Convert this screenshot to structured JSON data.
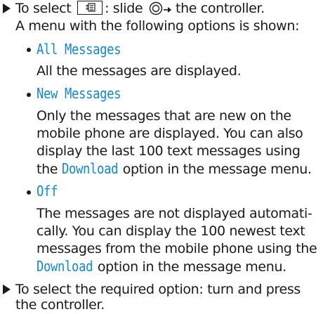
{
  "colors": {
    "text": "#1a1a1a",
    "ui_text": "#1a86c7"
  },
  "icons": {
    "step_marker": "triangle-right-icon",
    "bullet": "bullet-icon",
    "button": "message-menu-button-icon",
    "controller": "controller-slide-icon"
  },
  "step1": {
    "text_a": "To select",
    "text_b": ": slide",
    "text_c": "the controller.",
    "line2": "A menu with the following options is shown:"
  },
  "options": [
    {
      "label": "All Messages",
      "desc": [
        "All the messages are displayed."
      ]
    },
    {
      "label": "New Messages",
      "desc_1": "Only the messages that are new on the",
      "desc_2": "mobile phone are displayed. You can also",
      "desc_3": "display the last 100 text messages using",
      "desc_4a": "the",
      "desc_4_ui": "Download",
      "desc_4b": "option in the message menu."
    },
    {
      "label": "Off",
      "desc_1": "The messages are not displayed automati-",
      "desc_2": "cally. You can display the 100 newest text",
      "desc_3": "messages from the mobile phone using the",
      "desc_4_ui": "Download",
      "desc_4b": "option in the message menu."
    }
  ],
  "step2": {
    "line1": "To select the required option: turn and press",
    "line2": "the controller."
  }
}
